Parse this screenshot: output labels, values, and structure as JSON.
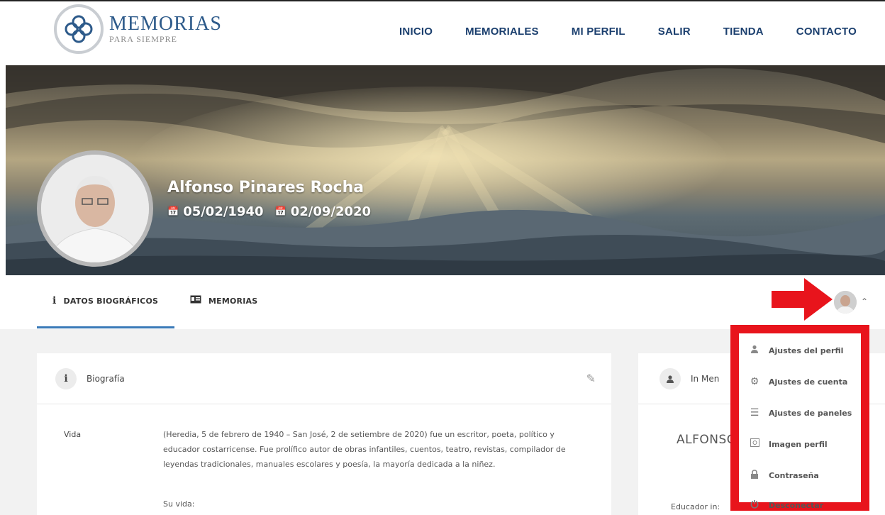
{
  "logo": {
    "title": "MEMORIAS",
    "subtitle": "PARA SIEMPRE"
  },
  "nav": {
    "items": [
      {
        "label": "INICIO"
      },
      {
        "label": "MEMORIALES"
      },
      {
        "label": "MI PERFIL"
      },
      {
        "label": "SALIR"
      },
      {
        "label": "TIENDA"
      },
      {
        "label": "CONTACTO"
      }
    ]
  },
  "profile": {
    "name": "Alfonso Pinares Rocha",
    "birth": "05/02/1940",
    "death": "02/09/2020"
  },
  "tabs": [
    {
      "label": "DATOS BIOGRÁFICOS",
      "icon": "info-icon"
    },
    {
      "label": "MEMORIAS",
      "icon": "id-card-icon"
    }
  ],
  "bio": {
    "title": "Biografía",
    "label": "Vida",
    "text": "(Heredia, 5 de febrero de 1940 – San José, 2 de setiembre de 2020) fue un escritor, poeta, político y educador costarricense. Fue prolífico autor de obras infantiles, cuentos, teatro, revistas, compilador de leyendas tradicionales, manuales escolares y poesía, la mayoría dedicada a la niñez.",
    "subheading": "Su vida:"
  },
  "memoriam": {
    "title": "In Men",
    "name": "ALFONSC",
    "note": "Educador in:"
  },
  "dropdown": {
    "items": [
      {
        "label": "Ajustes del perfil",
        "icon": "user-icon"
      },
      {
        "label": "Ajustes de cuenta",
        "icon": "gears-icon"
      },
      {
        "label": "Ajustes de paneles",
        "icon": "sliders-icon"
      },
      {
        "label": "Imagen perfil",
        "icon": "image-icon"
      },
      {
        "label": "Contraseña",
        "icon": "lock-icon"
      },
      {
        "label": "Desconectar",
        "icon": "power-icon"
      }
    ]
  },
  "colors": {
    "nav": "#1b3f6e",
    "accent": "#3a7ab8",
    "highlight": "#e8141c"
  }
}
